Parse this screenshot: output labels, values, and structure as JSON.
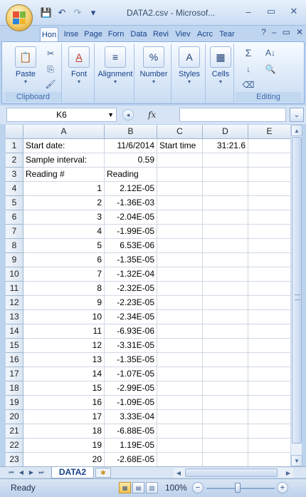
{
  "window": {
    "title": "DATA2.csv - Microsof...",
    "controls": {
      "minimize": "–",
      "restore": "▭",
      "close": "✕"
    }
  },
  "quick_access": {
    "save_icon": "💾",
    "undo_icon": "↶",
    "redo_icon": "↷",
    "more_icon": "▾"
  },
  "ribbon_tabs": [
    {
      "label": "Hon",
      "active": true
    },
    {
      "label": "Inse",
      "active": false
    },
    {
      "label": "Page",
      "active": false
    },
    {
      "label": "Forn",
      "active": false
    },
    {
      "label": "Data",
      "active": false
    },
    {
      "label": "Revi",
      "active": false
    },
    {
      "label": "Viev",
      "active": false
    },
    {
      "label": "Acrc",
      "active": false
    },
    {
      "label": "Tear",
      "active": false
    }
  ],
  "ribbon_right": {
    "help_icon": "?",
    "min_icon": "–",
    "restore_icon": "▭",
    "close_icon": "✕"
  },
  "ribbon": {
    "clipboard": {
      "paste": "Paste",
      "group_label": "Clipboard",
      "cut_icon": "✂",
      "copy_icon": "⎘",
      "format_painter_icon": "🖌"
    },
    "font": {
      "label": "Font",
      "icon": "A"
    },
    "alignment": {
      "label": "Alignment",
      "icon": "≡"
    },
    "number": {
      "label": "Number",
      "icon": "%"
    },
    "styles": {
      "label": "Styles",
      "icon": "A"
    },
    "cells": {
      "label": "Cells",
      "icon": "▦"
    },
    "editing": {
      "group_label": "Editing",
      "sum_icon": "Σ",
      "sort_icon": "A↓",
      "find_icon": "🔍",
      "fill_icon": "↓",
      "clear_icon": "⌫"
    }
  },
  "formula_bar": {
    "name_box": "K6",
    "fx": "fx",
    "value": "",
    "expand_icon": "⌄"
  },
  "columns": [
    {
      "label": "A"
    },
    {
      "label": "B"
    },
    {
      "label": "C"
    },
    {
      "label": "D"
    },
    {
      "label": "E"
    }
  ],
  "rows": [
    {
      "n": "1",
      "a": "Start date:",
      "b": "11/6/2014",
      "c": "Start time",
      "d": "31:21.6"
    },
    {
      "n": "2",
      "a": "Sample interval:",
      "b": "0.59",
      "c": "",
      "d": ""
    },
    {
      "n": "3",
      "a": "Reading #",
      "b": "Reading",
      "c": "",
      "d": ""
    },
    {
      "n": "4",
      "a": "1",
      "b": "2.12E-05",
      "c": "",
      "d": ""
    },
    {
      "n": "5",
      "a": "2",
      "b": "-1.36E-03",
      "c": "",
      "d": ""
    },
    {
      "n": "6",
      "a": "3",
      "b": "-2.04E-05",
      "c": "",
      "d": ""
    },
    {
      "n": "7",
      "a": "4",
      "b": "-1.99E-05",
      "c": "",
      "d": ""
    },
    {
      "n": "8",
      "a": "5",
      "b": "6.53E-06",
      "c": "",
      "d": ""
    },
    {
      "n": "9",
      "a": "6",
      "b": "-1.35E-05",
      "c": "",
      "d": ""
    },
    {
      "n": "10",
      "a": "7",
      "b": "-1.32E-04",
      "c": "",
      "d": ""
    },
    {
      "n": "11",
      "a": "8",
      "b": "-2.32E-05",
      "c": "",
      "d": ""
    },
    {
      "n": "12",
      "a": "9",
      "b": "-2.23E-05",
      "c": "",
      "d": ""
    },
    {
      "n": "13",
      "a": "10",
      "b": "-2.34E-05",
      "c": "",
      "d": ""
    },
    {
      "n": "14",
      "a": "11",
      "b": "-6.93E-06",
      "c": "",
      "d": ""
    },
    {
      "n": "15",
      "a": "12",
      "b": "-3.31E-05",
      "c": "",
      "d": ""
    },
    {
      "n": "16",
      "a": "13",
      "b": "-1.35E-05",
      "c": "",
      "d": ""
    },
    {
      "n": "17",
      "a": "14",
      "b": "-1.07E-05",
      "c": "",
      "d": ""
    },
    {
      "n": "18",
      "a": "15",
      "b": "-2.99E-05",
      "c": "",
      "d": ""
    },
    {
      "n": "19",
      "a": "16",
      "b": "-1.09E-05",
      "c": "",
      "d": ""
    },
    {
      "n": "20",
      "a": "17",
      "b": "3.33E-04",
      "c": "",
      "d": ""
    },
    {
      "n": "21",
      "a": "18",
      "b": "-6.88E-05",
      "c": "",
      "d": ""
    },
    {
      "n": "22",
      "a": "19",
      "b": "1.19E-05",
      "c": "",
      "d": ""
    },
    {
      "n": "23",
      "a": "20",
      "b": "-2.68E-05",
      "c": "",
      "d": ""
    }
  ],
  "sheets": {
    "active": "DATA2",
    "nav": [
      "⏮",
      "◀",
      "▶",
      "⏭"
    ],
    "new_sheet_icon": "✱"
  },
  "status": {
    "text": "Ready",
    "zoom": "100%",
    "zoom_out": "−",
    "zoom_in": "+"
  }
}
